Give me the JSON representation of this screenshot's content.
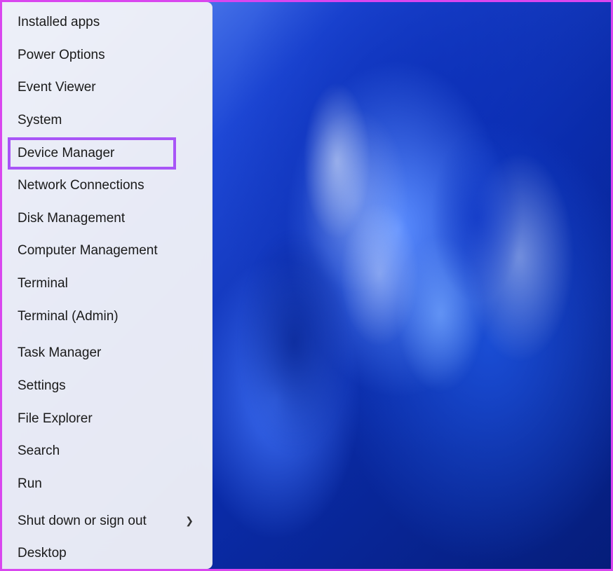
{
  "menu": {
    "groups": [
      [
        {
          "id": "installed-apps",
          "label": "Installed apps"
        },
        {
          "id": "power-options",
          "label": "Power Options"
        },
        {
          "id": "event-viewer",
          "label": "Event Viewer"
        },
        {
          "id": "system",
          "label": "System"
        },
        {
          "id": "device-manager",
          "label": "Device Manager",
          "highlighted": true
        },
        {
          "id": "network-connections",
          "label": "Network Connections"
        },
        {
          "id": "disk-management",
          "label": "Disk Management"
        },
        {
          "id": "computer-management",
          "label": "Computer Management"
        },
        {
          "id": "terminal",
          "label": "Terminal"
        },
        {
          "id": "terminal-admin",
          "label": "Terminal (Admin)"
        }
      ],
      [
        {
          "id": "task-manager",
          "label": "Task Manager"
        },
        {
          "id": "settings",
          "label": "Settings"
        },
        {
          "id": "file-explorer",
          "label": "File Explorer"
        },
        {
          "id": "search",
          "label": "Search"
        },
        {
          "id": "run",
          "label": "Run"
        }
      ],
      [
        {
          "id": "shut-down-or-sign-out",
          "label": "Shut down or sign out",
          "submenu": true
        },
        {
          "id": "desktop",
          "label": "Desktop"
        }
      ]
    ]
  },
  "annotation": {
    "highlight_color": "#a855f7",
    "frame_color": "#d946ef"
  }
}
